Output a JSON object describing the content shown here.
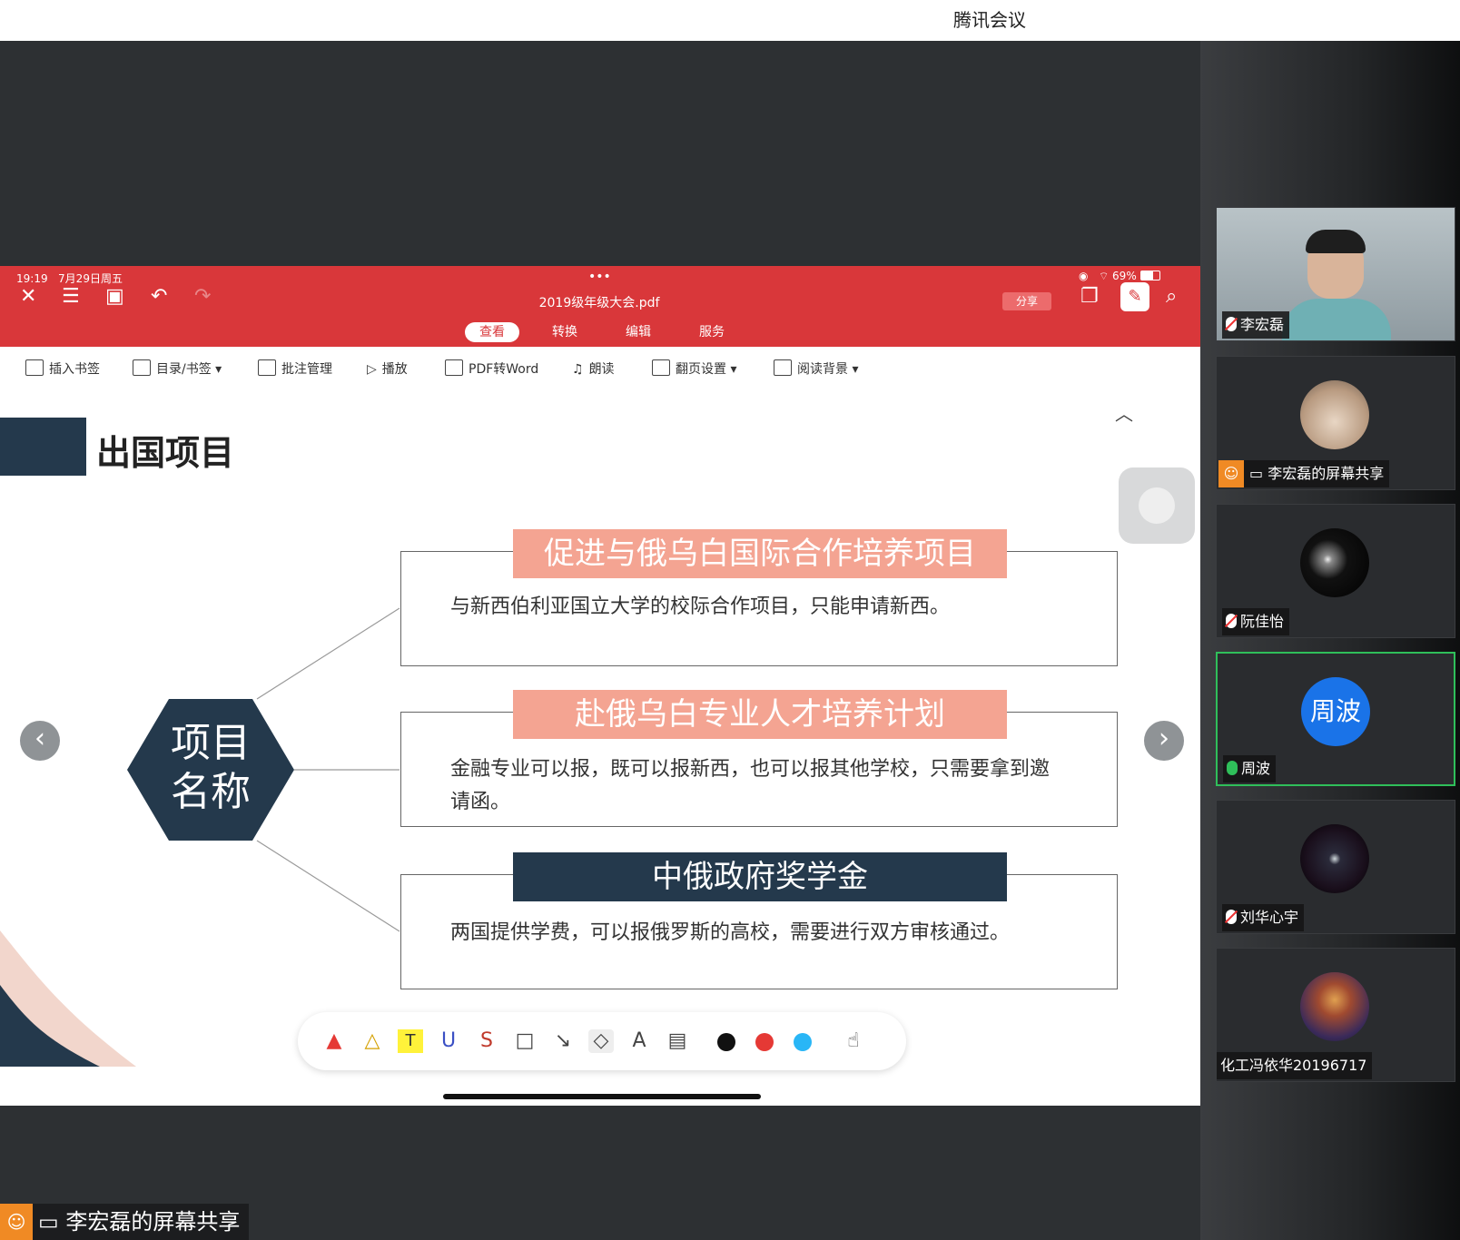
{
  "window": {
    "title": "腾讯会议"
  },
  "pdf_app": {
    "status_time": "19:19",
    "status_date": "7月29日周五",
    "status_battery": "69%",
    "doc_title": "2019级年级大会.pdf",
    "share_label": "分享",
    "mode_tabs": [
      {
        "label": "查看",
        "active": true
      },
      {
        "label": "转换",
        "active": false
      },
      {
        "label": "编辑",
        "active": false
      },
      {
        "label": "服务",
        "active": false
      }
    ],
    "tools": [
      {
        "label": "插入书签"
      },
      {
        "label": "目录/书签"
      },
      {
        "label": "批注管理"
      },
      {
        "label": "播放"
      },
      {
        "label": "PDF转Word"
      },
      {
        "label": "朗读"
      },
      {
        "label": "翻页设置"
      },
      {
        "label": "阅读背景"
      }
    ],
    "colors": {
      "accent": "#d9373a",
      "slide_dark": "#24394c",
      "slide_pink": "#f4a492"
    }
  },
  "slide": {
    "title": "出国项目",
    "center_line1": "项目",
    "center_line2": "名称",
    "items": [
      {
        "label": "促进与俄乌白国际合作培养项目",
        "text": "与新西伯利亚国立大学的校际合作项目，只能申请新西。"
      },
      {
        "label": "赴俄乌白专业人才培养计划",
        "text": "金融专业可以报，既可以报新西，也可以报其他学校，只需要拿到邀请函。"
      },
      {
        "label": "中俄政府奖学金",
        "text": "两国提供学费，可以报俄罗斯的高校，需要进行双方审核通过。"
      }
    ]
  },
  "annotation_colors": [
    "#111111",
    "#e53935",
    "#29b6f6"
  ],
  "participants": [
    {
      "name": "李宏磊",
      "mic": "muted",
      "type": "video"
    },
    {
      "name": "李宏磊的屏幕共享",
      "mic": "share",
      "type": "avatar"
    },
    {
      "name": "阮佳怡",
      "mic": "muted",
      "type": "avatar"
    },
    {
      "name": "周波",
      "mic": "on",
      "type": "initials",
      "initials": "周波"
    },
    {
      "name": "刘华心宇",
      "mic": "muted",
      "type": "avatar"
    },
    {
      "name": "化工冯依华20196717",
      "mic": "none",
      "type": "avatar"
    }
  ],
  "share_label_bottom": "李宏磊的屏幕共享"
}
